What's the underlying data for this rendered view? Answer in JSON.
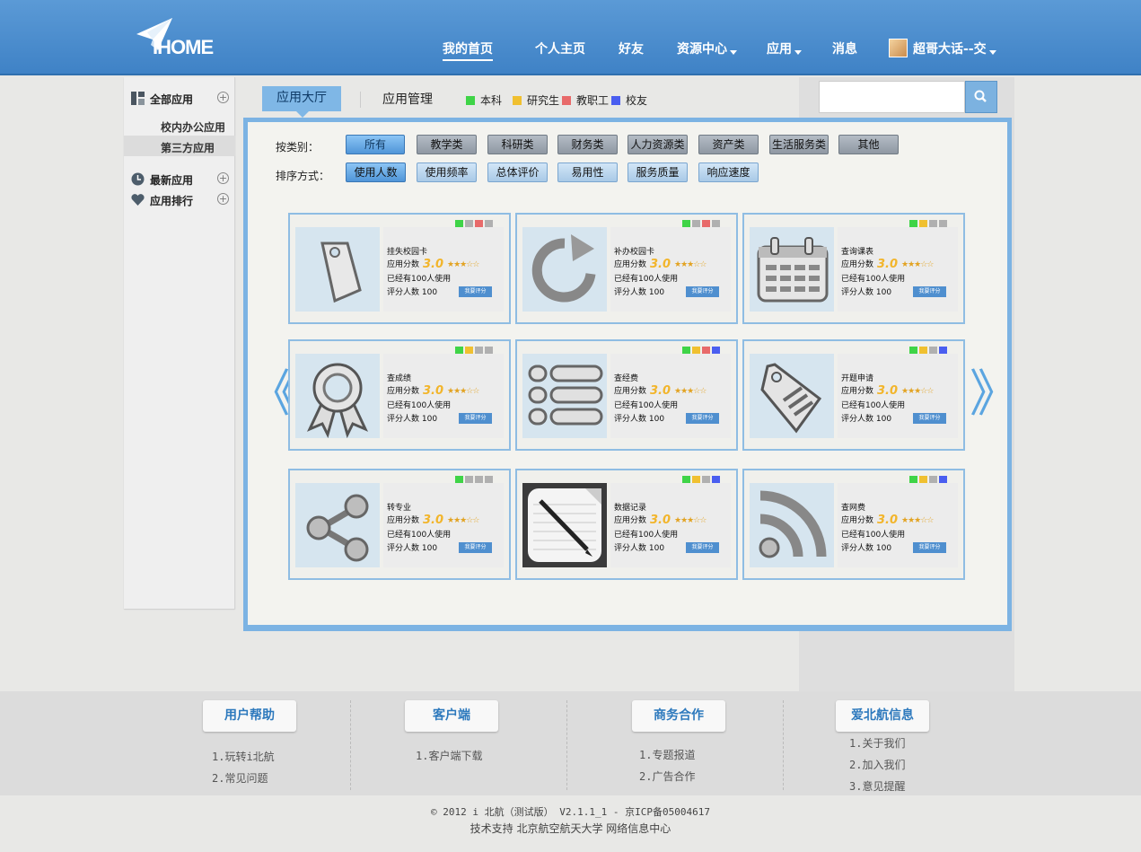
{
  "header": {
    "logo_text": "IHOME",
    "nav": [
      {
        "label": "我的首页",
        "active": true
      },
      {
        "label": "个人主页"
      },
      {
        "label": "好友"
      },
      {
        "label": "资源中心"
      },
      {
        "label": "应用"
      },
      {
        "label": "消息"
      }
    ],
    "user_name": "超哥大话--交"
  },
  "sidebar": {
    "all_apps": "全部应用",
    "sub_campus": "校内办公应用",
    "sub_third": "第三方应用",
    "latest": "最新应用",
    "ranking": "应用排行"
  },
  "tabs": {
    "hall": "应用大厅",
    "manage": "应用管理"
  },
  "legend": [
    {
      "label": "本科",
      "color": "#3fd447"
    },
    {
      "label": "研究生",
      "color": "#f0c030"
    },
    {
      "label": "教职工",
      "color": "#e86a6a"
    },
    {
      "label": "校友",
      "color": "#4a5ef0"
    }
  ],
  "search": {
    "placeholder": ""
  },
  "filters": {
    "category_label": "按类别：",
    "categories": [
      "所有",
      "教学类",
      "科研类",
      "财务类",
      "人力资源类",
      "资产类",
      "生活服务类",
      "其他"
    ],
    "sort_label": "排序方式：",
    "sorts": [
      "使用人数",
      "使用频率",
      "总体评价",
      "易用性",
      "服务质量",
      "响应速度"
    ]
  },
  "card_labels": {
    "score_label": "应用分数",
    "score": "3.0",
    "stars": "★★★☆☆",
    "users": "已经有100人使用",
    "count": "评分人数 100",
    "rate_button": "我要评分"
  },
  "apps": [
    {
      "name": "挂失校园卡",
      "icon": "tag-icon",
      "dots": [
        "#3fd447",
        "#b0b0b0",
        "#e86a6a",
        "#b0b0b0"
      ]
    },
    {
      "name": "补办校园卡",
      "icon": "refresh-icon",
      "dots": [
        "#3fd447",
        "#b0b0b0",
        "#e86a6a",
        "#b0b0b0"
      ]
    },
    {
      "name": "查询课表",
      "icon": "calendar-icon",
      "dots": [
        "#3fd447",
        "#f0c030",
        "#b0b0b0",
        "#b0b0b0"
      ]
    },
    {
      "name": "查成绩",
      "icon": "award-icon",
      "dots": [
        "#3fd447",
        "#f0c030",
        "#b0b0b0",
        "#b0b0b0"
      ]
    },
    {
      "name": "查经费",
      "icon": "list-icon",
      "dots": [
        "#3fd447",
        "#f0c030",
        "#e86a6a",
        "#4a5ef0"
      ]
    },
    {
      "name": "开题申请",
      "icon": "price-tag-icon",
      "dots": [
        "#3fd447",
        "#f0c030",
        "#b0b0b0",
        "#4a5ef0"
      ]
    },
    {
      "name": "转专业",
      "icon": "share-icon",
      "dots": [
        "#3fd447",
        "#b0b0b0",
        "#b0b0b0",
        "#b0b0b0"
      ]
    },
    {
      "name": "数据记录",
      "icon": "notepad-pen-icon",
      "dots": [
        "#3fd447",
        "#f0c030",
        "#b0b0b0",
        "#4a5ef0"
      ]
    },
    {
      "name": "查网费",
      "icon": "rss-icon",
      "dots": [
        "#3fd447",
        "#f0c030",
        "#b0b0b0",
        "#4a5ef0"
      ]
    }
  ],
  "footer": {
    "columns": [
      {
        "title": "用户帮助",
        "links": [
          "1.玩转i北航",
          "2.常见问题"
        ]
      },
      {
        "title": "客户端",
        "links": [
          "1.客户端下载"
        ]
      },
      {
        "title": "商务合作",
        "links": [
          "1.专题报道",
          "2.广告合作"
        ]
      },
      {
        "title": "爱北航信息",
        "links": [
          "1.关于我们",
          "2.加入我们",
          "3.意见提醒"
        ]
      }
    ],
    "copyright": "© 2012 i 北航（测试版） V2.1.1_1 - 京ICP备05004617",
    "support": "技术支持 北京航空航天大学 网络信息中心"
  }
}
